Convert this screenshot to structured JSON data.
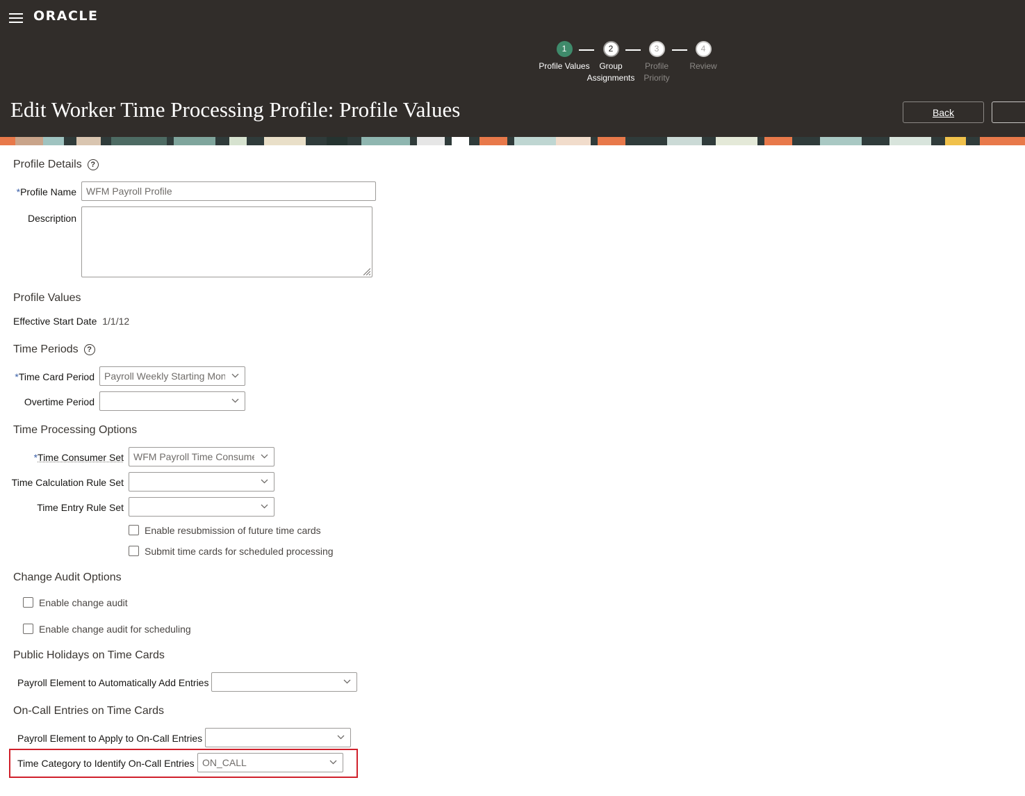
{
  "header": {
    "logo": "ORACLE",
    "title": "Edit Worker Time Processing Profile: Profile Values",
    "back_label": "Back"
  },
  "steps": [
    {
      "number": "1",
      "label": "Profile Values",
      "state": "active"
    },
    {
      "number": "2",
      "label": "Group Assignments",
      "state": "next"
    },
    {
      "number": "3",
      "label": "Profile Priority",
      "state": "disabled"
    },
    {
      "number": "4",
      "label": "Review",
      "state": "disabled"
    }
  ],
  "profile_details": {
    "section": "Profile Details",
    "profile_name_label": "Profile Name",
    "profile_name_value": "WFM Payroll Profile",
    "description_label": "Description",
    "description_value": ""
  },
  "profile_values": {
    "section": "Profile Values",
    "effective_start_label": "Effective Start Date",
    "effective_start_value": "1/1/12"
  },
  "time_periods": {
    "section": "Time Periods",
    "time_card_period_label": "Time Card Period",
    "time_card_period_value": "Payroll Weekly Starting Mon",
    "overtime_period_label": "Overtime Period",
    "overtime_period_value": ""
  },
  "time_processing": {
    "section": "Time Processing Options",
    "consumer_set_label": "Time Consumer Set",
    "consumer_set_value": "WFM Payroll Time Consume",
    "calc_rule_label": "Time Calculation Rule Set",
    "calc_rule_value": "",
    "entry_rule_label": "Time Entry Rule Set",
    "entry_rule_value": "",
    "resubmission_label": "Enable resubmission of future time cards",
    "scheduled_label": "Submit time cards for scheduled processing"
  },
  "change_audit": {
    "section": "Change Audit Options",
    "enable_label": "Enable change audit",
    "scheduling_label": "Enable change audit for scheduling"
  },
  "public_holidays": {
    "section": "Public Holidays on Time Cards",
    "payroll_element_label": "Payroll Element to Automatically Add Entries",
    "payroll_element_value": ""
  },
  "on_call": {
    "section": "On-Call Entries on Time Cards",
    "payroll_element_label": "Payroll Element to Apply to On-Call Entries",
    "payroll_element_value": "",
    "time_category_label": "Time Category to Identify On-Call Entries",
    "time_category_value": "ON_CALL"
  },
  "colors": {
    "header_bg": "#312d2a",
    "active_step": "#3f8a6b",
    "highlight": "#d0202b",
    "required": "#3a60a8"
  }
}
